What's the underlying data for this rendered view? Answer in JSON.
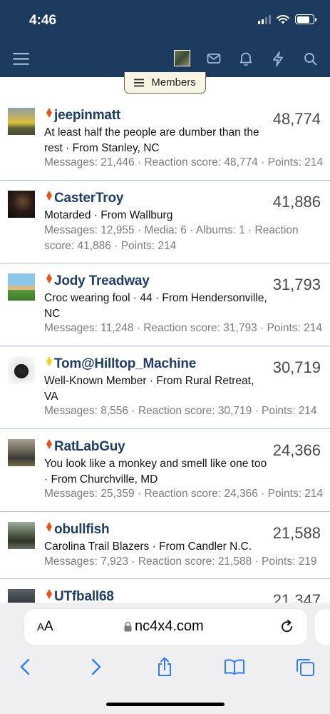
{
  "status": {
    "time": "4:46"
  },
  "nav": {
    "menu_icon": "hamburger-icon",
    "icons": [
      "avatar",
      "mail-icon",
      "bell-icon",
      "bolt-icon",
      "search-icon"
    ]
  },
  "members_tab": {
    "label": "Members"
  },
  "members": [
    {
      "name": "jeepinmatt",
      "rank_color": "#e8541e",
      "score": "48,774",
      "desc": "At least half the people are dumber than the rest · From Stanley, NC",
      "stats": "Messages: 21,446 · Reaction score: 48,774 · Points: 214"
    },
    {
      "name": "CasterTroy",
      "rank_color": "#e8541e",
      "score": "41,886",
      "desc": "Motarded · From Wallburg",
      "stats": "Messages: 12,955 · Media: 6 · Albums: 1 · Reaction score: 41,886 · Points: 214"
    },
    {
      "name": "Jody Treadway",
      "rank_color": "#e8541e",
      "score": "31,793",
      "desc": "Croc wearing fool · 44 · From Hendersonville, NC",
      "stats": "Messages: 11,248 · Reaction score: 31,793 · Points: 214"
    },
    {
      "name": "Tom@Hilltop_Machine",
      "rank_color": "#f2d21b",
      "score": "30,719",
      "desc": "Well-Known Member · From Rural Retreat, VA",
      "stats": "Messages: 8,556 · Reaction score: 30,719 · Points: 214"
    },
    {
      "name": "RatLabGuy",
      "rank_color": "#e8541e",
      "score": "24,366",
      "desc": "You look like a monkey and smell like one too · From Churchville, MD",
      "stats": "Messages: 25,359 · Reaction score: 24,366 · Points: 214"
    },
    {
      "name": "obullfish",
      "rank_color": "#e8541e",
      "score": "21,588",
      "desc": "Carolina Trail Blazers · From Candler N.C.",
      "stats": "Messages: 7,923 · Reaction score: 21,588 · Points: 219"
    },
    {
      "name": "UTfball68",
      "rank_color": "#e8541e",
      "score": "21,347",
      "desc": "",
      "stats": ""
    }
  ],
  "safari": {
    "aa_label_big": "A",
    "aa_label_small": "A",
    "url": "nc4x4.com",
    "buttons": [
      "back-icon",
      "forward-icon",
      "share-icon",
      "bookmarks-icon",
      "tabs-icon"
    ]
  }
}
